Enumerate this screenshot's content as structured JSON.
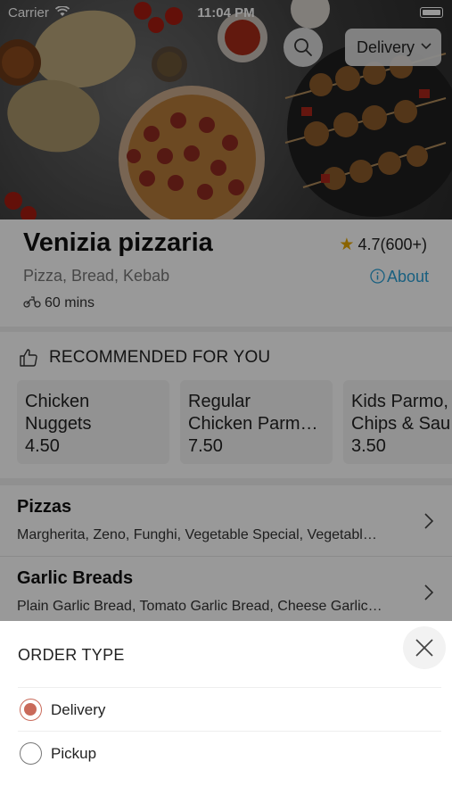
{
  "status_bar": {
    "carrier": "Carrier",
    "time": "11:04 PM"
  },
  "header": {
    "search_icon": "search-icon",
    "order_type_button": "Delivery"
  },
  "restaurant": {
    "name": "Venizia pizzaria",
    "rating": "4.7(600+)",
    "cuisines": "Pizza, Bread, Kebab",
    "about_label": "About",
    "eta": "60 mins"
  },
  "recommended": {
    "title": "RECOMMENDED FOR YOU",
    "items": [
      {
        "name": "Chicken\nNuggets",
        "price": "4.50"
      },
      {
        "name": "Regular\nChicken Parm…",
        "price": "7.50"
      },
      {
        "name": "Kids Parmo,\nChips & Sau",
        "price": "3.50"
      }
    ]
  },
  "categories": [
    {
      "title": "Pizzas",
      "description": "Margherita, Zeno, Funghi, Vegetable Special, Vegetabl…"
    },
    {
      "title": "Garlic Breads",
      "description": "Plain Garlic Bread, Tomato Garlic Bread, Cheese Garlic…"
    }
  ],
  "order_sheet": {
    "title": "ORDER TYPE",
    "options": [
      {
        "label": "Delivery",
        "selected": true
      },
      {
        "label": "Pickup",
        "selected": false
      }
    ]
  },
  "colors": {
    "accent_radio": "#c96a5a",
    "about_link": "#2aa0d6",
    "star": "#e6a700"
  }
}
